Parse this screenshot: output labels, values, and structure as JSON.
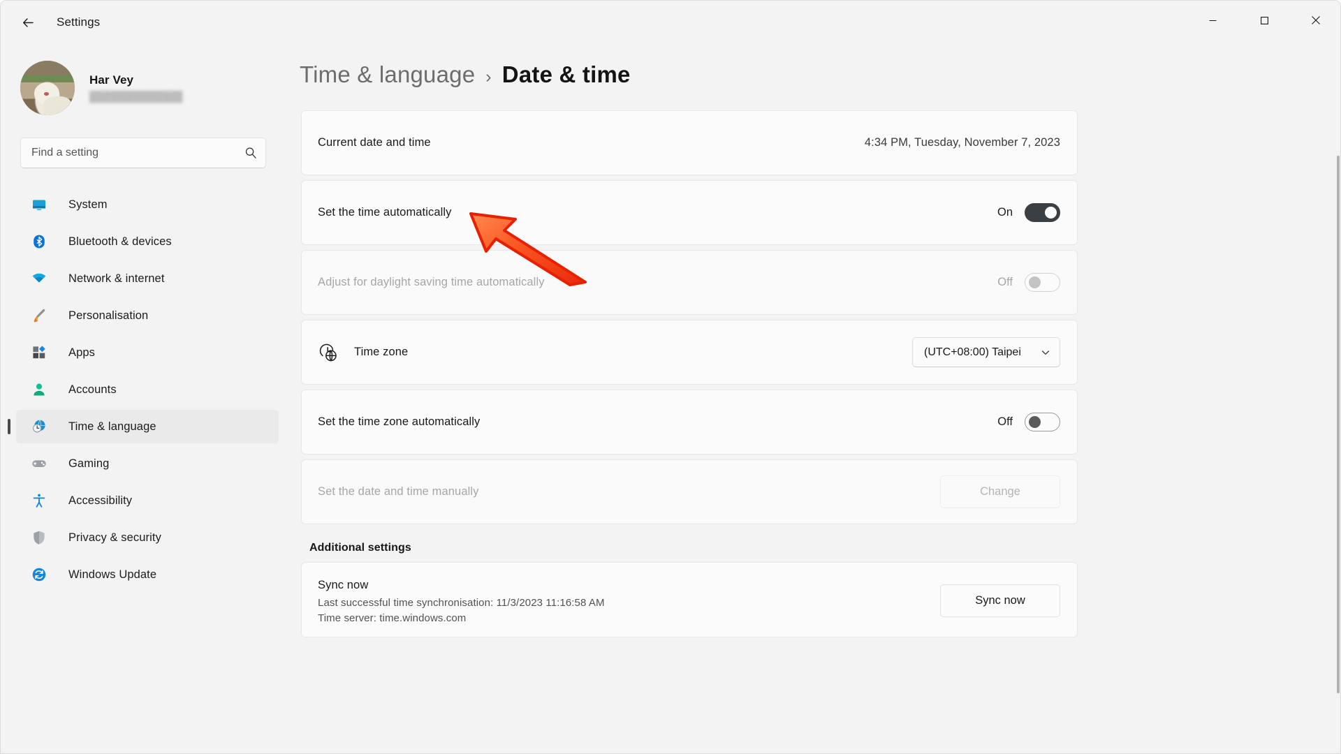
{
  "window": {
    "app_title": "Settings",
    "back_icon": "back-arrow-icon",
    "minimize_icon": "minimize-icon",
    "maximize_icon": "maximize-icon",
    "close_icon": "close-icon"
  },
  "sidebar": {
    "profile": {
      "name": "Har Vey",
      "email": "",
      "avatar_icon": "user-avatar-photo"
    },
    "search": {
      "placeholder": "Find a setting",
      "value": "",
      "icon": "search-icon"
    },
    "items": [
      {
        "label": "System",
        "icon": "monitor-icon",
        "selected": false
      },
      {
        "label": "Bluetooth & devices",
        "icon": "bluetooth-icon",
        "selected": false
      },
      {
        "label": "Network & internet",
        "icon": "wifi-icon",
        "selected": false
      },
      {
        "label": "Personalisation",
        "icon": "paintbrush-icon",
        "selected": false
      },
      {
        "label": "Apps",
        "icon": "apps-grid-icon",
        "selected": false
      },
      {
        "label": "Accounts",
        "icon": "person-icon",
        "selected": false
      },
      {
        "label": "Time & language",
        "icon": "clock-globe-icon",
        "selected": true
      },
      {
        "label": "Gaming",
        "icon": "gamepad-icon",
        "selected": false
      },
      {
        "label": "Accessibility",
        "icon": "accessibility-icon",
        "selected": false
      },
      {
        "label": "Privacy & security",
        "icon": "shield-icon",
        "selected": false
      },
      {
        "label": "Windows Update",
        "icon": "refresh-circle-icon",
        "selected": false
      }
    ]
  },
  "main": {
    "breadcrumb": {
      "parent": "Time & language",
      "separator": "›",
      "current": "Date & time"
    },
    "rows": {
      "current_datetime": {
        "label": "Current date and time",
        "value": "4:34 PM, Tuesday, November 7, 2023"
      },
      "set_time_auto": {
        "label": "Set the time automatically",
        "state": "On"
      },
      "daylight_saving": {
        "label": "Adjust for daylight saving time automatically",
        "state": "Off"
      },
      "time_zone": {
        "label": "Time zone",
        "icon": "clock-globe-icon",
        "selected_option": "(UTC+08:00) Taipei",
        "chevron_icon": "chevron-down-icon"
      },
      "set_timezone_auto": {
        "label": "Set the time zone automatically",
        "state": "Off"
      },
      "set_manually": {
        "label": "Set the date and time manually",
        "button_label": "Change"
      }
    },
    "additional_settings": {
      "heading": "Additional settings",
      "sync": {
        "title": "Sync now",
        "last_sync": "Last successful time synchronisation: 11/3/2023 11:16:58 AM",
        "time_server": "Time server: time.windows.com",
        "button_label": "Sync now"
      }
    }
  },
  "annotation": {
    "arrow_icon": "red-arrow-pointer",
    "arrow_color": "#F4391A"
  }
}
